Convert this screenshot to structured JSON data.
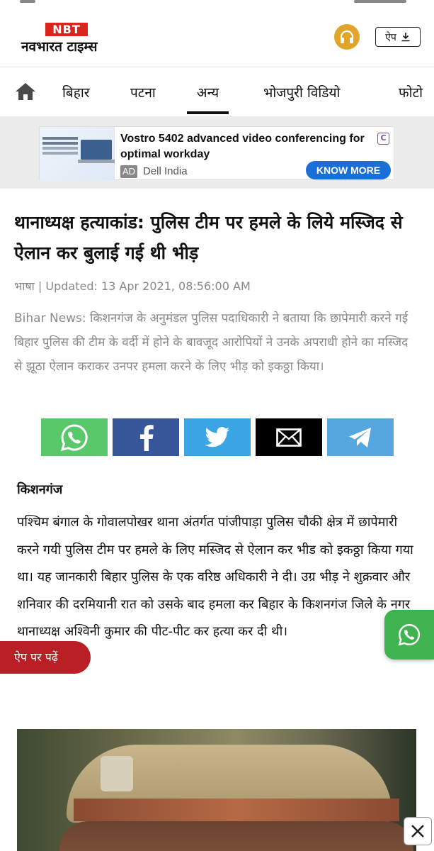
{
  "header": {
    "logo_top": "NBT",
    "logo_name": "नवभारत टाइम्स",
    "app_button_label": "ऐप"
  },
  "nav": {
    "items": [
      {
        "label": "बिहार",
        "active": false
      },
      {
        "label": "पटना",
        "active": false
      },
      {
        "label": "अन्य",
        "active": true
      },
      {
        "label": "भोजपुरी विडियो",
        "active": false
      },
      {
        "label": "फोटो",
        "active": false
      }
    ]
  },
  "ad": {
    "title": "Vostro 5402 advanced video conferencing for optimal workday",
    "badge": "AD",
    "advertiser": "Dell India",
    "cta": "KNOW MORE"
  },
  "article": {
    "headline": "थानाध्यक्ष हत्याकांड: पुलिस टीम पर हमले के लिये मस्जिद से ऐलान कर बुलाई गई थी भीड़",
    "source": "भाषा",
    "updated": "Updated: 13 Apr 2021, 08:56:00 AM",
    "summary": "Bihar News: किशनगंज के अनुमंडल पुलिस पदाधिकारी ने बताया कि छापेमारी करने गई बिहार पुलिस की टीम के वर्दी में होने के बावजूद आरोपियों ने उनके अपराधी होने का मस्जिद से झूठा ऐलान कराकर उनपर हमला करने के लिए भीड़ को इकठ्ठा किया।",
    "dateline": "किशनगंज",
    "body": "पश्चिम बंगाल के गोवालपोखर थाना अंतर्गत पांजीपाड़ा पुलिस चौकी क्षेत्र में छापेमारी करने गयी पुलिस टीम पर हमले के लिए मस्जिद से ऐलान कर भीड को इकठ्ठा किया गया था। यह जानकारी बिहार पुलिस के एक वरिष्ठ अधिकारी ने दी। उग्र भीड़ ने शुक्रवार और शनिवार की दरमियानी रात को उसके बाद हमला कर बिहार के किशनगंज जिले के नगर थानाध्यक्ष अश्विनी कुमार की पीट-पीट कर हत्या कर दी थी।"
  },
  "share": {
    "buttons": [
      {
        "icon": "whatsapp-icon",
        "color": "#58c86a"
      },
      {
        "icon": "facebook-icon",
        "color": "#37569a"
      },
      {
        "icon": "twitter-icon",
        "color": "#3aa4e4"
      },
      {
        "icon": "mail-icon",
        "color": "#000000"
      },
      {
        "icon": "telegram-icon",
        "color": "#56a6e0"
      }
    ]
  },
  "floating": {
    "read_in_app": "ऐप पर पढ़ें"
  },
  "colors": {
    "brand_red": "#d9251c",
    "read_app_red": "#b91f24",
    "whatsapp_green": "#3fb34f",
    "cta_blue": "#1a6ed8"
  }
}
